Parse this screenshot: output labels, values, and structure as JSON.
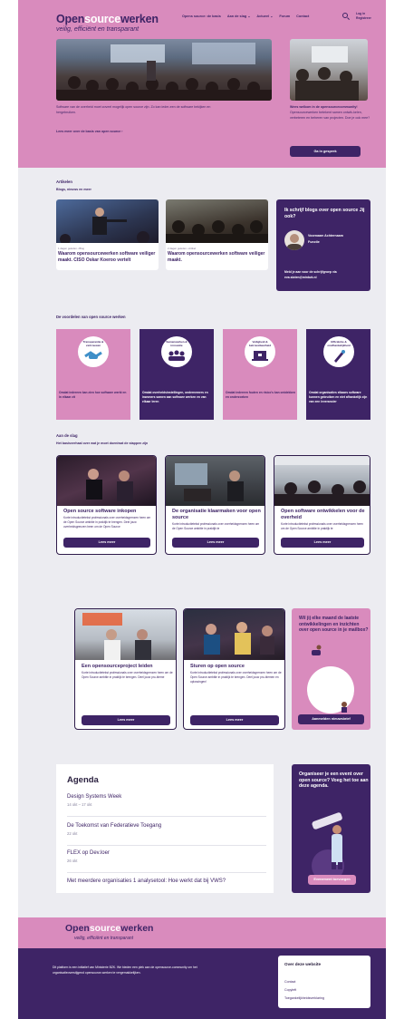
{
  "header": {
    "logo_open": "Open",
    "logo_source": "source",
    "logo_werken": "werken",
    "tagline": "veilig, efficiënt en transparant",
    "nav": [
      "Opens source: de basis",
      "Aan de slag ⌄",
      "Actueel ⌄",
      "Forum",
      "Contact"
    ],
    "login": "Log in",
    "register": "Registreer"
  },
  "intro": {
    "left_text": "Software van de overheid moet zoveel mogelijk open source zijn. Zo kan ieder-een de software bekijken en hergebruiken.",
    "left_link": "Lees meer over de basis van open source  ›",
    "right_title": "Wees welkom in de opensourcecommunity!",
    "right_text": "Opensourcewerken betekent samen ontwik-kelen, verbeteren en beheren van projecten. Doe je ook mee?",
    "right_button": "Ga in gesprek"
  },
  "articles": {
    "heading": "Artikelen",
    "subheading": "Blogs, nieuws en meer",
    "items": [
      {
        "meta": "1 dagen geleden • Blog",
        "title": "Waarom opensourcewerken software veiliger maakt. CISO Oskar Koeroo vertelt"
      },
      {
        "meta": "2 dagen geleden • Artikel",
        "title": "Waarom opensourcewerken software veiliger maakt."
      }
    ],
    "blog_box": {
      "title": "Ik schrijf blogs over open source Jij ook?",
      "name": "Voornaam Achternaam",
      "role": "Functie",
      "text": "Meld je aan voor de schrijfgroep via eva.sloten@minbzk.nl"
    }
  },
  "benefits": {
    "heading": "De voordelen van open source werken",
    "items": [
      {
        "label": "Transparantie & vertrouwen",
        "text": "Omdat iedereen kan zien hoe software werkt en in elkaar zit",
        "icon": "handshake-icon"
      },
      {
        "label": "Samenwerken & innovatie",
        "text": "Omdat overheidsinstellingen, ondernemers en inwoners samen aan software werken en van elkaar leren",
        "icon": "people-icon"
      },
      {
        "label": "Veiligheid & betrouwbaarheid",
        "text": "Omdat iedereen fouten en risico's kan ontdekken en onderzoeken",
        "icon": "laptop-lock-icon"
      },
      {
        "label": "Efficiëntie & onafhankelijkheid",
        "text": "Omdat organisaties elkaars software kunnen gebruiken en niet afhankelijk zijn van een leverancier",
        "icon": "rocket-icon"
      }
    ]
  },
  "start": {
    "heading": "Aan de slag",
    "subheading": "Het basisverhaal over wat je moet doen/wat de stappen zijn",
    "cards": [
      {
        "title": "Open source software inkopen",
        "text": "Korte introductietekst professionals over overheidsgrenzen heen om de Open Source ambitie in praktijk te brengen. Deel jouw overheidsgrenzen heen om de Open Source",
        "button": "Lees meer"
      },
      {
        "title": "De organisatie klaarmaken voor open source",
        "text": "Korte introductietekst professionals over overheidsgrenzen heen om de Open Source ambitie in praktijk te",
        "button": "Lees meer"
      },
      {
        "title": "Open software ontwikkelen voor de overheid",
        "text": "Korte introductietekst professionals over overheidsgrenzen heen om de Open Source ambitie in praktijk te",
        "button": "Lees meer"
      },
      {
        "title": "Een opensourceproject leiden",
        "text": "Korte introductietekst professionals over overheidsgrenzen heen om de Open Source ambitie in praktijk te brengen. Deel jouw pro-bleme",
        "button": "Lees meer"
      },
      {
        "title": "Sturen op open source",
        "text": "Korte introductietekst professionals over overheidsgrenzen heen om de Open Source ambitie in praktijk te brengen. Deel jouw pro-blemen en oplossingen!",
        "button": "Lees meer"
      }
    ],
    "newsletter": {
      "title": "Wil jij elke maand de laatste ontwikkelingen en inzichten over open source in je mailbox?",
      "button": "Aanmelden nieuwsbrief"
    }
  },
  "agenda": {
    "heading": "Agenda",
    "items": [
      {
        "title": "Design Systems Week",
        "date": "14 okt – 17 okt"
      },
      {
        "title": "De Toekomst van Federatieve Toegang",
        "date": "22 okt"
      },
      {
        "title": "FLEX op Dev.loer",
        "date": "26 okt"
      },
      {
        "title": "Met meerdere organisaties 1 analysetool: Hoe werkt dat bij VWS?",
        "date": ""
      }
    ],
    "event_box": {
      "title": "Organiseer je een event over open source? Voeg het toe aan deze agenda.",
      "button": "Evenement toevoegen"
    }
  },
  "footer": {
    "logo_open": "Open",
    "logo_source": "source",
    "logo_werken": "werken",
    "tagline": "veilig, efficiënt en transparant",
    "text": "Dit platform is een initiatief van Ministerie BZK. We bieden een plek aan de opensource-community om het organisatieoverstijgend opensource-werken te vergemakkelijken.",
    "about_title": "Over deze website",
    "links": [
      "Contact",
      "Copyleft",
      "Toegankelijkheidsverklaring"
    ]
  },
  "colors": {
    "pink": "#d98bbd",
    "purple": "#3e2466",
    "background": "#ececf1"
  }
}
